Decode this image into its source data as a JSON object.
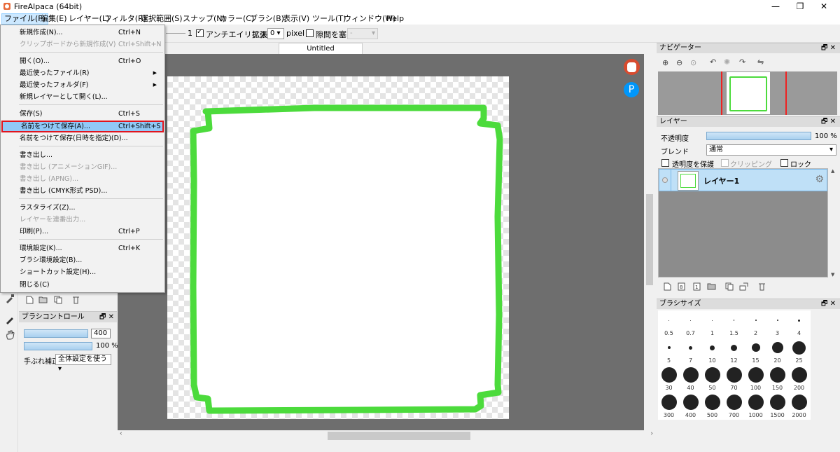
{
  "titlebar": {
    "title": "FireAlpaca (64bit)",
    "minimize": "—",
    "maximize": "❐",
    "close": "✕"
  },
  "menubar": [
    {
      "label": "ファイル(F)"
    },
    {
      "label": "編集(E)"
    },
    {
      "label": "レイヤー(L)"
    },
    {
      "label": "フィルタ(R)"
    },
    {
      "label": "選択範囲(S)"
    },
    {
      "label": "スナップ(N)"
    },
    {
      "label": "カラー(C)"
    },
    {
      "label": "ブラシ(B)"
    },
    {
      "label": "表示(V)"
    },
    {
      "label": "ツール(T)"
    },
    {
      "label": "ウィンドウ(W)"
    },
    {
      "label": "Help"
    }
  ],
  "toolbar": {
    "value_1": "1",
    "antialias_label": "アンチエイリアス",
    "expand_label": "拡張",
    "expand_value": "0",
    "pixel_label": "pixel",
    "close_gap_label": "隙間を塞ぐ",
    "close_gap_value": "-"
  },
  "file_menu": {
    "items": [
      {
        "label": "新規作成(N)...",
        "shortcut": "Ctrl+N",
        "disabled": false
      },
      {
        "label": "クリップボードから新規作成(V)",
        "shortcut": "Ctrl+Shift+N",
        "disabled": true
      },
      {
        "label": "開く(O)...",
        "shortcut": "Ctrl+O",
        "disabled": false
      },
      {
        "label": "最近使ったファイル(R)",
        "shortcut": "",
        "submenu": true,
        "disabled": false
      },
      {
        "label": "最近使ったフォルダ(F)",
        "shortcut": "",
        "submenu": true,
        "disabled": false
      },
      {
        "label": "新規レイヤーとして開く(L)...",
        "shortcut": "",
        "disabled": false
      },
      {
        "label": "保存(S)",
        "shortcut": "Ctrl+S",
        "disabled": false
      },
      {
        "label": "名前をつけて保存(A)...",
        "shortcut": "Ctrl+Shift+S",
        "disabled": false,
        "highlight": true
      },
      {
        "label": "名前をつけて保存(日時を指定)(D)...",
        "shortcut": "",
        "disabled": false
      },
      {
        "label": "書き出し...",
        "shortcut": "",
        "disabled": false
      },
      {
        "label": "書き出し (アニメーションGIF)...",
        "shortcut": "",
        "disabled": true
      },
      {
        "label": "書き出し (APNG)...",
        "shortcut": "",
        "disabled": true
      },
      {
        "label": "書き出し (CMYK形式 PSD)...",
        "shortcut": "",
        "disabled": false
      },
      {
        "label": "ラスタライズ(Z)...",
        "shortcut": "",
        "disabled": false
      },
      {
        "label": "レイヤーを連番出力...",
        "shortcut": "",
        "disabled": true
      },
      {
        "label": "印刷(P)...",
        "shortcut": "Ctrl+P",
        "disabled": false
      },
      {
        "label": "環境設定(K)...",
        "shortcut": "Ctrl+K",
        "disabled": false
      },
      {
        "label": "ブラシ環境設定(B)...",
        "shortcut": "",
        "disabled": false
      },
      {
        "label": "ショートカット設定(H)...",
        "shortcut": "",
        "disabled": false
      },
      {
        "label": "閉じる(C)",
        "shortcut": "",
        "disabled": false
      }
    ]
  },
  "document": {
    "tab_title": "Untitled"
  },
  "brush_control": {
    "title": "ブラシコントロール",
    "size_value": "400",
    "opacity_value": "100 %",
    "stabilizer_label": "手ぶれ補正",
    "stabilizer_value": "全体設定を使う"
  },
  "navigator": {
    "title": "ナビゲーター"
  },
  "layer_panel": {
    "title": "レイヤー",
    "opacity_label": "不透明度",
    "opacity_value": "100 %",
    "opacity_level": 1.0,
    "blend_label": "ブレンド",
    "blend_value": "通常",
    "protect_alpha_label": "透明度を保護",
    "clipping_label": "クリッピング",
    "lock_label": "ロック",
    "layers": [
      {
        "name": "レイヤー1"
      }
    ]
  },
  "brush_size_panel": {
    "title": "ブラシサイズ",
    "sizes": [
      "0.5",
      "0.7",
      "1",
      "1.5",
      "2",
      "3",
      "4",
      "5",
      "7",
      "10",
      "12",
      "15",
      "20",
      "25",
      "30",
      "40",
      "50",
      "70",
      "100",
      "150",
      "200",
      "300",
      "400",
      "500",
      "700",
      "1000",
      "1500",
      "2000"
    ]
  },
  "colors": {
    "stroke_green": "#4cdb3c",
    "highlight_blue": "#91c9f7",
    "highlight_red": "#e0141e",
    "canvas_gray": "#6e6e6e"
  }
}
